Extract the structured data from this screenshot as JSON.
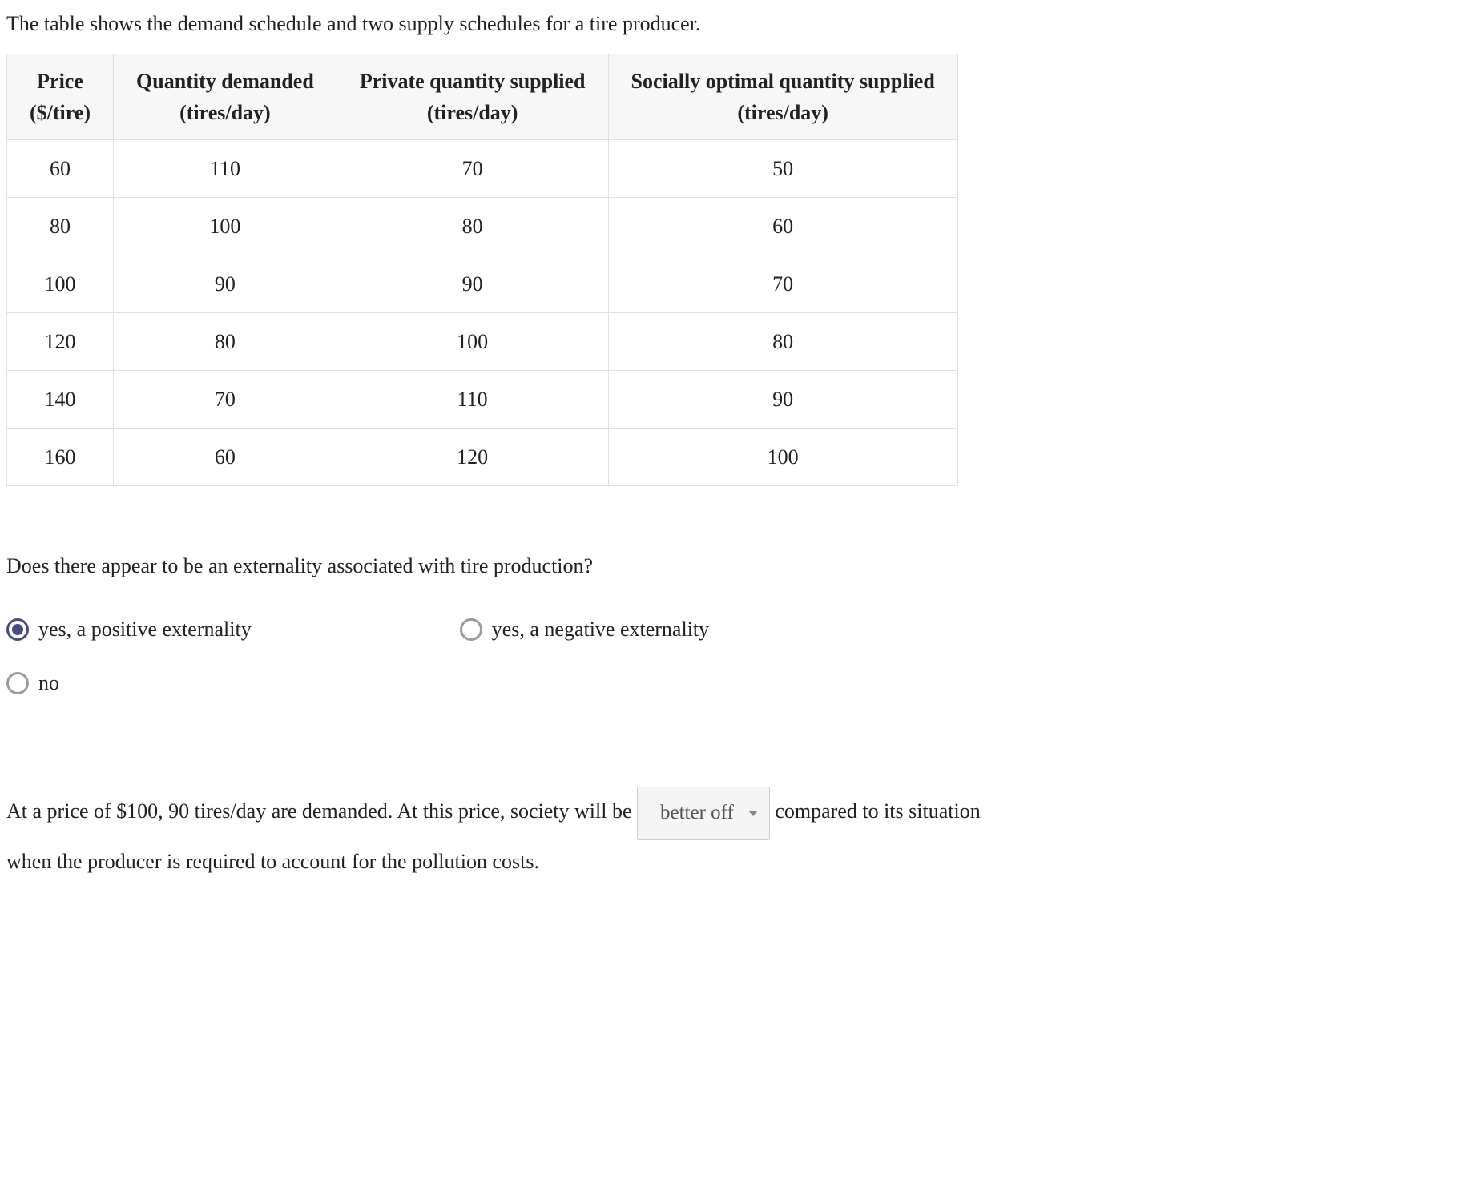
{
  "intro": "The table shows the demand schedule and two supply schedules for a tire producer.",
  "table": {
    "headers": [
      {
        "line1": "Price",
        "line2": "($/tire)"
      },
      {
        "line1": "Quantity demanded",
        "line2": "(tires/day)"
      },
      {
        "line1": "Private quantity supplied",
        "line2": "(tires/day)"
      },
      {
        "line1": "Socially optimal quantity supplied",
        "line2": "(tires/day)"
      }
    ],
    "rows": [
      {
        "c0": "60",
        "c1": "110",
        "c2": "70",
        "c3": "50"
      },
      {
        "c0": "80",
        "c1": "100",
        "c2": "80",
        "c3": "60"
      },
      {
        "c0": "100",
        "c1": "90",
        "c2": "90",
        "c3": "70"
      },
      {
        "c0": "120",
        "c1": "80",
        "c2": "100",
        "c3": "80"
      },
      {
        "c0": "140",
        "c1": "70",
        "c2": "110",
        "c3": "90"
      },
      {
        "c0": "160",
        "c1": "60",
        "c2": "120",
        "c3": "100"
      }
    ]
  },
  "question1": "Does there appear to be an externality associated with tire production?",
  "options": {
    "a": "yes, a positive externality",
    "b": "yes, a negative externality",
    "c": "no"
  },
  "sentence": {
    "part1": "At a price of $100, 90 tires/day are demanded. At this price, society will be",
    "dropdown": "better off",
    "part2": "compared to its situation",
    "part3": "when the producer is required to account for the pollution costs."
  }
}
